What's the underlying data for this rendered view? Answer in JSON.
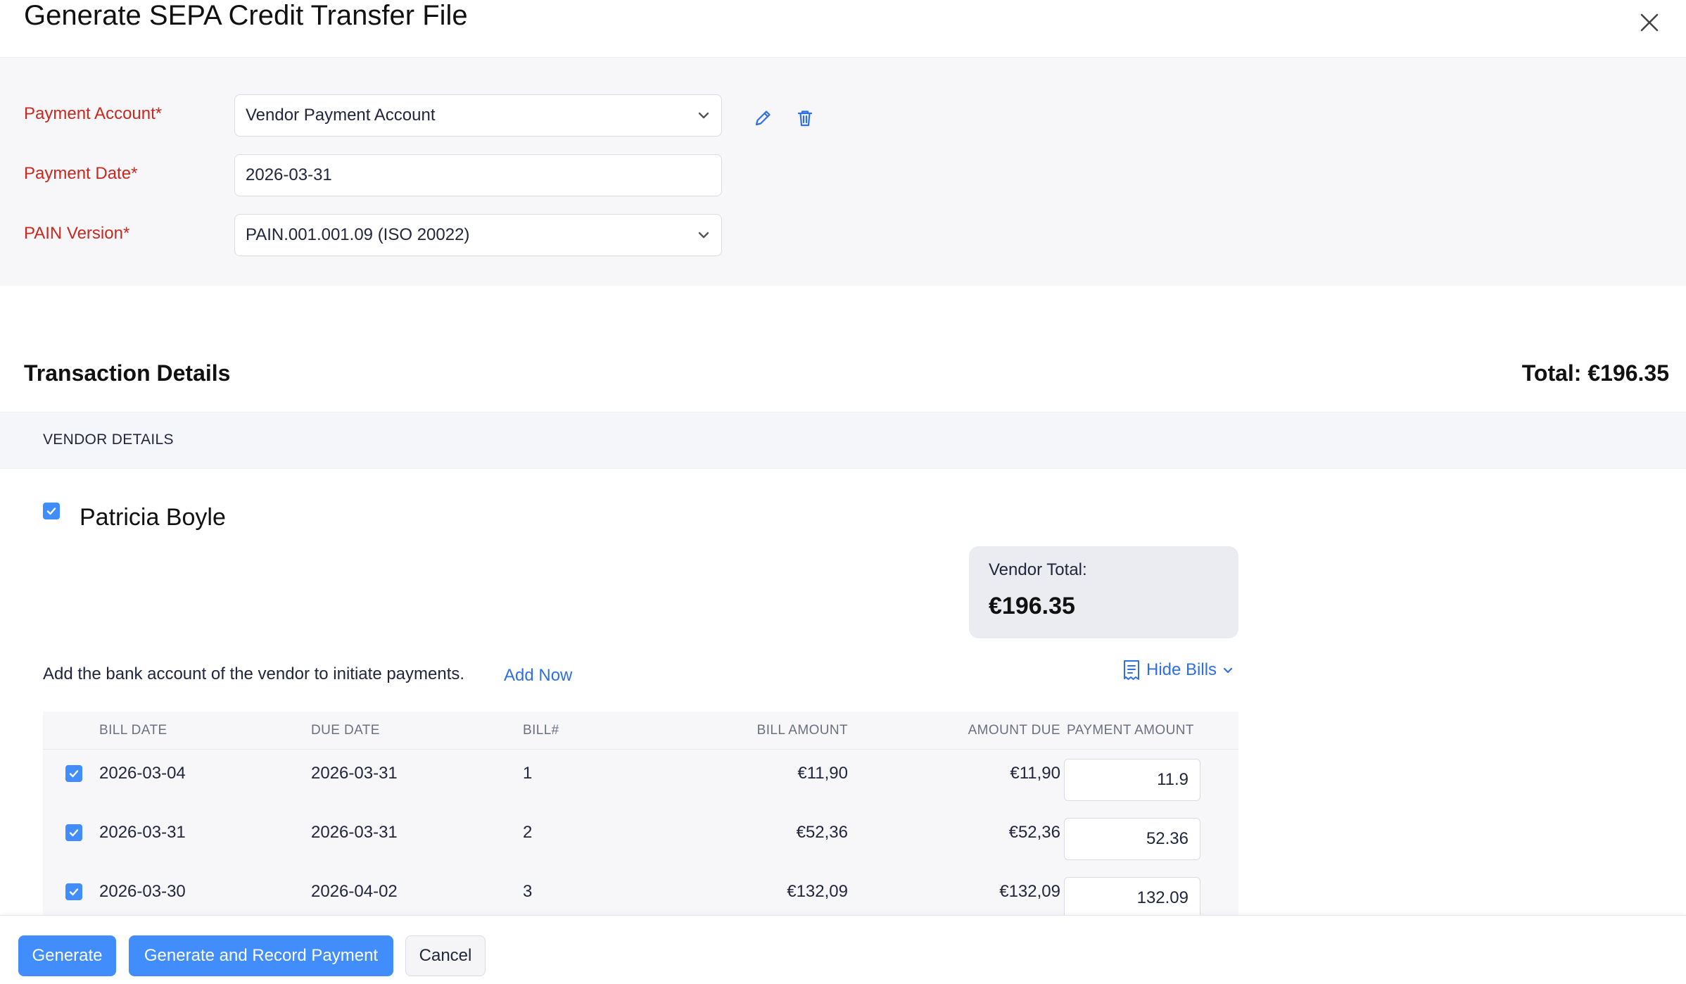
{
  "header": {
    "title": "Generate SEPA Credit Transfer File",
    "close_icon": "close-icon"
  },
  "form": {
    "payment_account": {
      "label": "Payment Account*",
      "value": "Vendor Payment Account"
    },
    "payment_date": {
      "label": "Payment Date*",
      "value": "2026-03-31"
    },
    "pain_version": {
      "label": "PAIN Version*",
      "value": "PAIN.001.001.09 (ISO 20022)"
    },
    "icons": {
      "edit": "pencil-icon",
      "delete": "trash-icon"
    }
  },
  "transactions": {
    "title": "Transaction Details",
    "total": "Total: €196.35",
    "vendor_details_header": "VENDOR DETAILS",
    "vendor": {
      "name": "Patricia Boyle",
      "checked": true,
      "total_label": "Vendor Total:",
      "total_amount": "€196.35",
      "bank_note": "Add the bank account of the vendor to initiate payments.",
      "add_now": "Add Now",
      "hide_bills": "Hide Bills"
    },
    "table": {
      "headers": [
        "BILL DATE",
        "DUE DATE",
        "BILL#",
        "BILL AMOUNT",
        "AMOUNT DUE",
        "PAYMENT AMOUNT"
      ],
      "rows": [
        {
          "bill_date": "2026-03-04",
          "due_date": "2026-03-31",
          "bill_no": "1",
          "bill_amount": "€11,90",
          "amount_due": "€11,90",
          "payment": "11.9",
          "checked": true
        },
        {
          "bill_date": "2026-03-31",
          "due_date": "2026-03-31",
          "bill_no": "2",
          "bill_amount": "€52,36",
          "amount_due": "€52,36",
          "payment": "52.36",
          "checked": true
        },
        {
          "bill_date": "2026-03-30",
          "due_date": "2026-04-02",
          "bill_no": "3",
          "bill_amount": "€132,09",
          "amount_due": "€132,09",
          "payment": "132.09",
          "checked": true
        }
      ]
    }
  },
  "footer": {
    "generate": "Generate",
    "generate_record": "Generate and Record Payment",
    "cancel": "Cancel"
  },
  "colors": {
    "accent": "#408dfb",
    "required_label": "#c8281e",
    "link": "#2f6fe5"
  }
}
